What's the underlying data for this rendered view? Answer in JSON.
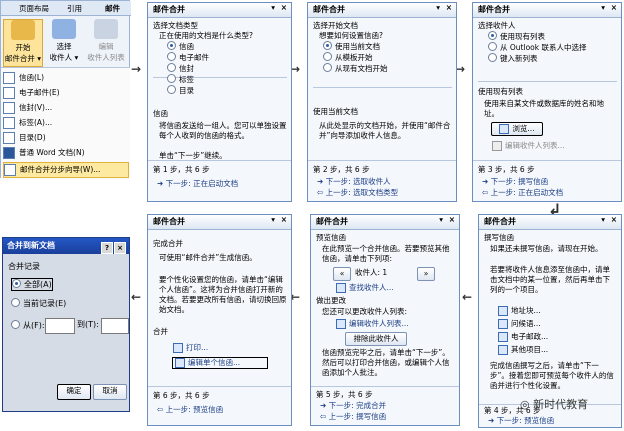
{
  "ribbon": {
    "tabs": [
      "页面布局",
      "引用",
      "邮件"
    ],
    "buttons": [
      {
        "label1": "开始",
        "label2": "邮件合并 ▾",
        "icon": "mail-merge-icon"
      },
      {
        "label1": "选择",
        "label2": "收件人 ▾",
        "icon": "select-recipients-icon"
      },
      {
        "label1": "编辑",
        "label2": "收件人列表",
        "icon": "edit-list-icon"
      }
    ],
    "menu": [
      "信函(L)",
      "电子邮件(E)",
      "信封(V)...",
      "标签(A)...",
      "目录(D)",
      "普通 Word 文档(N)",
      "邮件合并分步向导(W)..."
    ]
  },
  "pane1": {
    "title": "邮件合并",
    "section": "选择文档类型",
    "question": "正在使用的文档是什么类型?",
    "options": [
      "信函",
      "电子邮件",
      "信封",
      "标签",
      "目录"
    ],
    "desc_title": "信函",
    "desc": "将信函发送给一组人。您可以单独设置每个人收到的信函的格式。",
    "hint": "单击“下一步”继续。",
    "step": "第 1 步，共 6 步",
    "next": "下一步: 正在启动文档"
  },
  "pane2": {
    "title": "邮件合并",
    "section": "选择开始文档",
    "question": "想要如何设置信函?",
    "options": [
      "使用当前文档",
      "从模板开始",
      "从现有文档开始"
    ],
    "desc_title": "使用当前文档",
    "desc": "从此处显示的文档开始，并使用“邮件合并”向导添加收件人信息。",
    "step": "第 2 步，共 6 步",
    "next": "下一步: 选取收件人",
    "prev": "上一步: 选取文档类型"
  },
  "pane3": {
    "title": "邮件合并",
    "section": "选择收件人",
    "options": [
      "使用现有列表",
      "从 Outlook 联系人中选择",
      "键入新列表"
    ],
    "sub": "使用现有列表",
    "desc": "使用来自某文件或数据库的姓名和地址。",
    "browse": "浏览...",
    "edit": "编辑收件人列表...",
    "step": "第 3 步，共 6 步",
    "next": "下一步: 撰写信函",
    "prev": "上一步: 正在启动文档"
  },
  "pane4": {
    "title": "邮件合并",
    "section": "撰写信函",
    "p1": "如果还未撰写信函，请现在开始。",
    "p2": "若要将收件人信息添至信函中，请单击文档中的某一位置，然后再单击下列的一个项目。",
    "items": [
      "地址块...",
      "问候语...",
      "电子邮政...",
      "其他项目..."
    ],
    "p3": "完成信函撰写之后，请单击“下一步”。接着您即可预览每个收件人的信函并进行个性化设置。",
    "step": "第 4 步，共 6 步",
    "next": "下一步: 预览信函"
  },
  "pane5": {
    "title": "邮件合并",
    "section": "预览信函",
    "p1": "在此预览一个合并信函。若要预览其他信函，请单击下列项:",
    "recipient": "收件人: 1",
    "find": "查找收件人...",
    "changes": "做出更改",
    "p2": "您还可以更改收件人列表:",
    "edit": "编辑收件人列表...",
    "exclude": "排除此收件人",
    "p3": "信函预览完毕之后，请单击“下一步”。然后可以打印合并信函，或编辑个人信函添加个人批注。",
    "step": "第 5 步，共 6 步",
    "next": "下一步: 完成合并",
    "prev": "上一步: 撰写信函"
  },
  "pane6": {
    "title": "邮件合并",
    "section": "完成合并",
    "p1": "可使用“邮件合并”生成信函。",
    "p2": "要个性化设置您的信函，请单击“编辑个人信函”。这将为合并信函打开新的文档。若要更改所有信函，请切换回原始文档。",
    "merge": "合并",
    "print": "打印...",
    "edit": "编辑单个信函...",
    "step": "第 6 步，共 6 步",
    "prev": "上一步: 预览信函"
  },
  "dialog": {
    "title": "合并到新文档",
    "group": "合并记录",
    "all": "全部(A)",
    "current": "当前记录(E)",
    "from": "从(F):",
    "to": "到(T):",
    "ok": "确定",
    "cancel": "取消"
  },
  "watermark": "新时代教育"
}
